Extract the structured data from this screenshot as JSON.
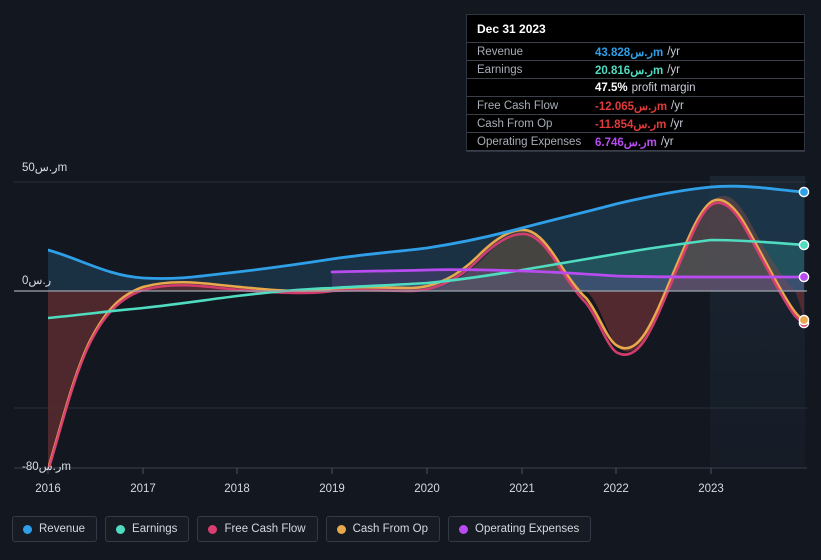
{
  "chart_data": {
    "type": "line",
    "title": "",
    "xlabel": "",
    "ylabel": "",
    "currency_symbol": "ر.س",
    "unit_suffix": "m",
    "x": [
      2016,
      2017,
      2018,
      2019,
      2020,
      2021,
      2022,
      2023
    ],
    "xlim": [
      2015.85,
      2024.1
    ],
    "ylim": [
      -80,
      56
    ],
    "y_ticks": [
      {
        "value": 50,
        "label": "50ر.سm"
      },
      {
        "value": 0,
        "label": "0ر.س"
      },
      {
        "value": -80,
        "label": "-80ر.سm"
      }
    ],
    "gridlines": [
      50,
      0,
      -50
    ],
    "x_tick_labels": [
      "2016",
      "2017",
      "2018",
      "2019",
      "2020",
      "2021",
      "2022",
      "2023"
    ],
    "legend_position": "bottom-left",
    "series": [
      {
        "name": "Revenue",
        "color": "#2f9fe8",
        "values": [
          18.5,
          13.0,
          13.5,
          16.0,
          19.0,
          24.5,
          32.0,
          41.0,
          43.828
        ]
      },
      {
        "name": "Earnings",
        "color": "#4fdcc0",
        "values": [
          -13.5,
          -11.5,
          -6.0,
          -4.0,
          -2.5,
          1.5,
          6.5,
          15.0,
          20.816
        ]
      },
      {
        "name": "Free Cash Flow",
        "color": "#d93e71",
        "values": [
          -82.0,
          -6.5,
          1.5,
          -0.5,
          3.0,
          23.5,
          -5.0,
          -27.0,
          33.0,
          -12.065
        ]
      },
      {
        "name": "Cash From Op",
        "color": "#e8a84c",
        "values": [
          -82.0,
          -6.0,
          2.0,
          0.0,
          3.5,
          24.0,
          -4.0,
          -24.5,
          34.0,
          -11.854
        ]
      },
      {
        "name": "Operating Expenses",
        "color": "#b84cf0",
        "start_year": 2019,
        "values": [
          6.0,
          6.4,
          7.0,
          6.6,
          6.4,
          6.746
        ]
      }
    ]
  },
  "tooltip": {
    "title": "Dec 31 2023",
    "rows": [
      {
        "label": "Revenue",
        "value": "43.828ر.سm",
        "suffix": "/yr",
        "color_key": "v-revenue"
      },
      {
        "label": "Earnings",
        "value": "20.816ر.سm",
        "suffix": "/yr",
        "color_key": "v-earnings"
      },
      {
        "label": "",
        "value": "47.5%",
        "sub_label": "profit margin",
        "color_key": "v-white"
      },
      {
        "label": "Free Cash Flow",
        "value": "-12.065ر.سm",
        "suffix": "/yr",
        "color_key": "v-neg"
      },
      {
        "label": "Cash From Op",
        "value": "-11.854ر.سm",
        "suffix": "/yr",
        "color_key": "v-neg"
      },
      {
        "label": "Operating Expenses",
        "value": "6.746ر.سm",
        "suffix": "/yr",
        "color_key": "v-opex"
      }
    ]
  },
  "legend": {
    "items": [
      {
        "label": "Revenue",
        "color": "#2f9fe8"
      },
      {
        "label": "Earnings",
        "color": "#4fdcc0"
      },
      {
        "label": "Free Cash Flow",
        "color": "#d93e71"
      },
      {
        "label": "Cash From Op",
        "color": "#e8a84c"
      },
      {
        "label": "Operating Expenses",
        "color": "#b84cf0"
      }
    ]
  },
  "axis": {
    "y_top": "50ر.سm",
    "y_zero": "0ر.س",
    "y_bottom": "-80ر.سm",
    "x_labels": [
      "2016",
      "2017",
      "2018",
      "2019",
      "2020",
      "2021",
      "2022",
      "2023"
    ]
  },
  "colors": {
    "background": "#13171f",
    "plot_positive_fill": "#1d3a52",
    "plot_negative_fill": "#5a2b30",
    "grid": "#2a303b",
    "zero_line": "#9aa2ae"
  }
}
